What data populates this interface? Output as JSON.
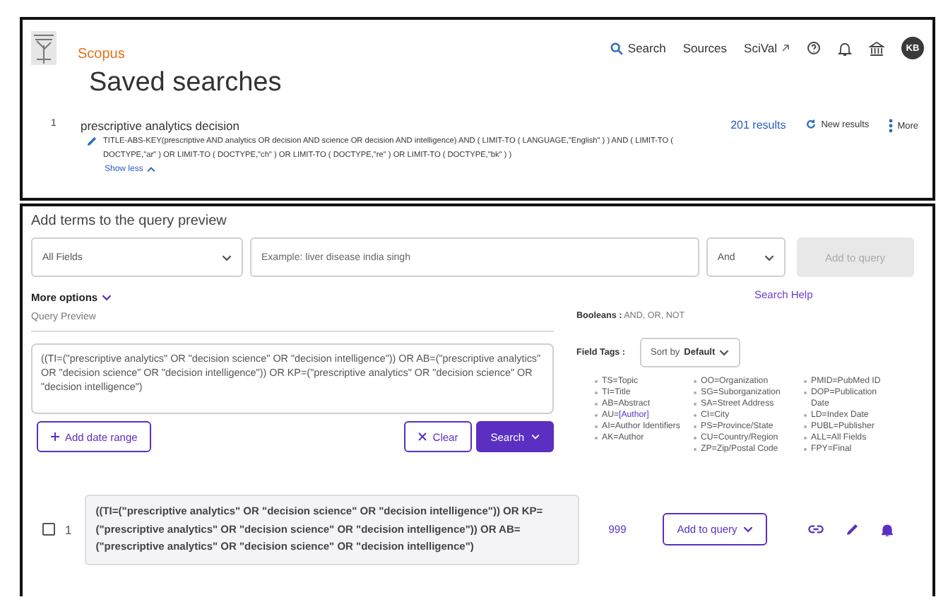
{
  "header": {
    "logo_text": "Scopus",
    "nav": [
      {
        "label": "Search",
        "kind": "search"
      },
      {
        "label": "Sources",
        "kind": "plain"
      },
      {
        "label": "SciVal",
        "kind": "external"
      }
    ],
    "avatar": "KB"
  },
  "page_title": "Saved searches",
  "saved_searches": [
    {
      "index": "1",
      "name": "prescriptive analytics decision",
      "query": "TITLE-ABS-KEY(prescriptive AND analytics OR decision AND science OR decision AND intelligence) AND ( LIMIT-TO ( LANGUAGE,\"English\" ) ) AND ( LIMIT-TO ( DOCTYPE,\"ar\" ) OR LIMIT-TO ( DOCTYPE,\"ch\" ) OR LIMIT-TO ( DOCTYPE,\"re\" ) OR LIMIT-TO ( DOCTYPE,\"bk\" ) )",
      "toggle": "Show less",
      "results": "201 results",
      "new_results": "New results",
      "more": "More"
    }
  ],
  "builder": {
    "heading": "Add terms to the query preview",
    "field_select": "All Fields",
    "term_placeholder": "Example: liver disease india singh",
    "operator": "And",
    "add_button": {
      "label": "Add to query",
      "disabled": true
    },
    "more_options": "More options",
    "search_help": "Search Help",
    "preview_label": "Query Preview",
    "preview_text": "((TI=(\"prescriptive analytics\" OR \"decision science\" OR \"decision intelligence\")) OR AB=(\"prescriptive analytics\" OR \"decision science\" OR \"decision intelligence\")) OR KP=(\"prescriptive analytics\" OR \"decision science\" OR \"decision intelligence\")",
    "booleans_label": "Booleans :",
    "booleans": "AND, OR, NOT",
    "field_tags_label": "Field Tags :",
    "sort_prefix": "Sort by",
    "sort_value": "Default",
    "field_tag_columns": [
      [
        {
          "text": "TS=Topic"
        },
        {
          "text": "TI=Title"
        },
        {
          "text": "AB=Abstract"
        },
        {
          "text": "AU=",
          "link": "[Author]"
        },
        {
          "text": "AI=Author Identifiers"
        },
        {
          "text": "AK=Author"
        }
      ],
      [
        {
          "text": "OO=Organization"
        },
        {
          "text": "SG=Suborganization"
        },
        {
          "text": "SA=Street Address"
        },
        {
          "text": "CI=City"
        },
        {
          "text": "PS=Province/State"
        },
        {
          "text": "CU=Country/Region"
        },
        {
          "text": "ZP=Zip/Postal Code"
        }
      ],
      [
        {
          "text": "PMID=PubMed ID"
        },
        {
          "text": "DOP=Publication Date"
        },
        {
          "text": "LD=Index Date"
        },
        {
          "text": "PUBL=Publisher"
        },
        {
          "text": "ALL=All Fields"
        },
        {
          "text": "FPY=Final"
        }
      ]
    ],
    "date_range": "Add date range",
    "clear": "Clear",
    "search": "Search"
  },
  "results": [
    {
      "checked": false,
      "index": "1",
      "query": "((TI=(\"prescriptive analytics\" OR \"decision science\" OR \"decision intelligence\")) OR KP=(\"prescriptive analytics\" OR \"decision science\" OR \"decision intelligence\")) OR AB=(\"prescriptive analytics\" OR \"decision science\" OR \"decision intelligence\")",
      "count": "999",
      "add_button": "Add to query"
    }
  ]
}
